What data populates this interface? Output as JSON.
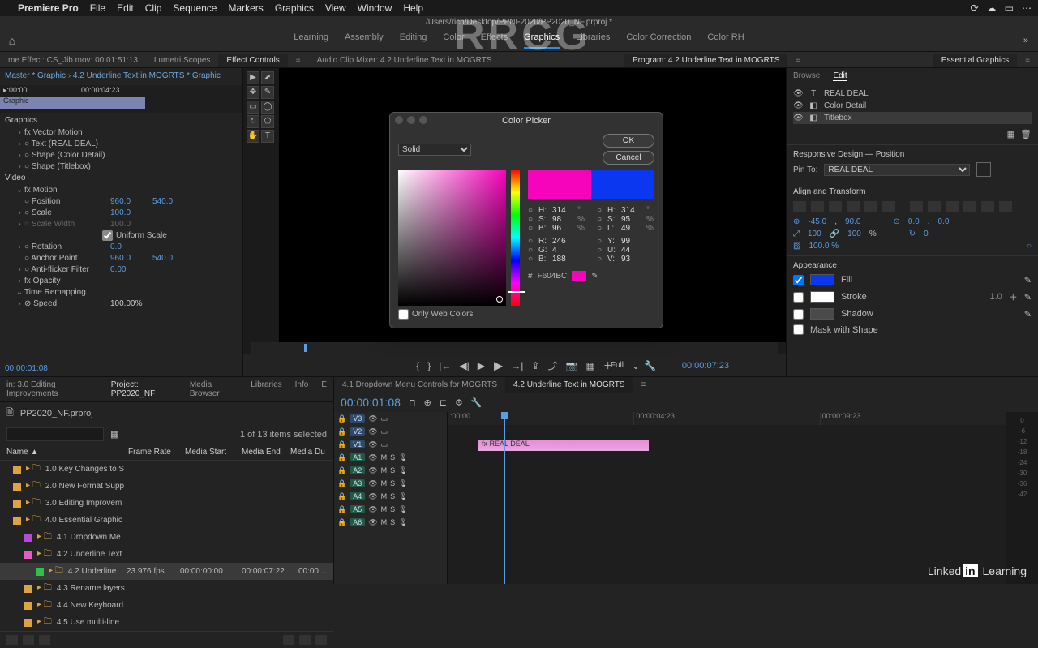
{
  "menubar": {
    "app": "Premiere Pro",
    "items": [
      "File",
      "Edit",
      "Clip",
      "Sequence",
      "Markers",
      "Graphics",
      "View",
      "Window",
      "Help"
    ]
  },
  "pathstrip": "/Users/rich/Desktop/PPNF2020/PP2020_NF.prproj *",
  "workspaces": {
    "items": [
      "Learning",
      "Assembly",
      "Editing",
      "Color",
      "Effects",
      "Graphics",
      "Libraries",
      "Color Correction",
      "Color RH"
    ],
    "active": 5
  },
  "top_tabs_left": {
    "frame_effect": "me Effect: CS_Jib.mov: 00:01:51:13",
    "lumetri": "Lumetri Scopes",
    "effect_controls": "Effect Controls",
    "audio_mixer": "Audio Clip Mixer: 4.2 Underline Text in MOGRTS"
  },
  "program_tab": "Program: 4.2 Underline Text in MOGRTS",
  "eg_title": "Essential Graphics",
  "effect_controls": {
    "crumb_master": "Master * Graphic",
    "crumb_target": "4.2 Underline Text in MOGRTS * Graphic",
    "tc_in": ":00:00",
    "tc_out": "00:00:04:23",
    "clip_label": "Graphic",
    "graphics_header": "Graphics",
    "items": [
      "Vector Motion",
      "Text (REAL DEAL)",
      "Shape (Color Detail)",
      "Shape (Titlebox)"
    ],
    "video_header": "Video",
    "motion": "Motion",
    "rows": [
      {
        "name": "Position",
        "v1": "960.0",
        "v2": "540.0"
      },
      {
        "name": "Scale",
        "v1": "100.0"
      },
      {
        "name": "Scale Width",
        "v1": "100.0"
      },
      {
        "name": "Uniform Scale",
        "check": true
      },
      {
        "name": "Rotation",
        "v1": "0.0"
      },
      {
        "name": "Anchor Point",
        "v1": "960.0",
        "v2": "540.0"
      },
      {
        "name": "Anti-flicker Filter",
        "v1": "0.00"
      }
    ],
    "opacity": "Opacity",
    "time_remap": "Time Remapping",
    "speed_label": "Speed",
    "speed_value": "100.00%",
    "bottom_tc": "00:00:01:08"
  },
  "transport": {
    "res": "Full",
    "tc": "00:00:07:23",
    "buttons": [
      "mark-in",
      "mark-out",
      "go-in",
      "step-back",
      "play",
      "step-fwd",
      "go-out",
      "lift",
      "extract",
      "export-frame",
      "btn1",
      "add"
    ]
  },
  "essential_graphics": {
    "tabs": [
      "Browse",
      "Edit"
    ],
    "active_tab": 1,
    "layers": [
      {
        "icon": "T",
        "label": "REAL DEAL"
      },
      {
        "icon": "shape",
        "label": "Color Detail"
      },
      {
        "icon": "shape",
        "label": "Titlebox"
      }
    ],
    "responsive_title": "Responsive Design — Position",
    "pin_label": "Pin To:",
    "pin_value": "REAL DEAL",
    "align_title": "Align and Transform",
    "nums": {
      "x": "-45.0",
      "y": "90.0",
      "ax": "0.0",
      "ay": "0.0",
      "sx": "100",
      "sy": "100",
      "rot": "0",
      "op": "100.0 %"
    },
    "appearance_title": "Appearance",
    "fill_label": "Fill",
    "fill_color": "#0b37f0",
    "stroke_label": "Stroke",
    "stroke_color": "#ffffff",
    "stroke_w": "1.0",
    "shadow_label": "Shadow",
    "shadow_color": "#4a4a4a",
    "mask_label": "Mask with Shape"
  },
  "project": {
    "tabs": [
      "in: 3.0 Editing Improvements",
      "Project: PP2020_NF",
      "Media Browser",
      "Libraries",
      "Info",
      "E"
    ],
    "active_tab": 1,
    "name": "PP2020_NF.prproj",
    "search_placeholder": "",
    "sel_info": "1 of 13 items selected",
    "cols": [
      "Name ▲",
      "Frame Rate",
      "Media Start",
      "Media End",
      "Media Du"
    ],
    "bins": [
      {
        "c": "#d9a441",
        "label": "1.0 Key Changes to S"
      },
      {
        "c": "#d9a441",
        "label": "2.0 New Format Supp"
      },
      {
        "c": "#d9a441",
        "label": "3.0 Editing Improvem"
      },
      {
        "c": "#d9a441",
        "label": "4.0 Essential Graphic"
      },
      {
        "c": "#b44bd8",
        "label": "4.1 Dropdown Me",
        "indent": 1
      },
      {
        "c": "#e65bbf",
        "label": "4.2 Underline Text",
        "indent": 1
      },
      {
        "c": "#2fbf4a",
        "label": "4.2 Underline",
        "indent": 2,
        "fr": "23.976 fps",
        "ms": "00:00:00:00",
        "me": "00:00:07:22",
        "md": "00:00…",
        "sel": true
      },
      {
        "c": "#d9a441",
        "label": "4.3 Rename layers",
        "indent": 1
      },
      {
        "c": "#d9a441",
        "label": "4.4 New Keyboard",
        "indent": 1
      },
      {
        "c": "#d9a441",
        "label": "4.5 Use multi-line",
        "indent": 1
      }
    ]
  },
  "timeline": {
    "tabs": [
      "4.1 Dropdown Menu Controls for MOGRTS",
      "4.2 Underline Text in MOGRTS"
    ],
    "active_tab": 1,
    "tc": "00:00:01:08",
    "ruler": [
      ":00:00",
      "00:00:04:23",
      "00:00:09:23"
    ],
    "tracks": [
      {
        "tag": "V3"
      },
      {
        "tag": "V2"
      },
      {
        "tag": "V1",
        "active": true
      },
      {
        "tag": "A1",
        "audio": true
      },
      {
        "tag": "A2",
        "audio": true
      },
      {
        "tag": "A3",
        "audio": true
      },
      {
        "tag": "A4",
        "audio": true
      },
      {
        "tag": "A5",
        "audio": true
      },
      {
        "tag": "A6",
        "audio": true
      }
    ],
    "clip_label": "REAL DEAL"
  },
  "meters": [
    "0",
    "-6",
    "-12",
    "-18",
    "-24",
    "-30",
    "-36",
    "-42"
  ],
  "color_picker": {
    "title": "Color Picker",
    "mode": "Solid",
    "ok": "OK",
    "cancel": "Cancel",
    "new_color": "#f604bc",
    "old_color": "#0b37f0",
    "hsb": [
      {
        "l": "H:",
        "v": "314",
        "u": "°"
      },
      {
        "l": "S:",
        "v": "98",
        "u": "%"
      },
      {
        "l": "B:",
        "v": "96",
        "u": "%"
      }
    ],
    "hsl": [
      {
        "l": "H:",
        "v": "314",
        "u": "°"
      },
      {
        "l": "S:",
        "v": "95",
        "u": "%"
      },
      {
        "l": "L:",
        "v": "49",
        "u": "%"
      }
    ],
    "rgb": [
      {
        "l": "R:",
        "v": "246"
      },
      {
        "l": "G:",
        "v": "4"
      },
      {
        "l": "B:",
        "v": "188"
      }
    ],
    "yuv": [
      {
        "l": "Y:",
        "v": "99"
      },
      {
        "l": "U:",
        "v": "44"
      },
      {
        "l": "V:",
        "v": "93"
      }
    ],
    "hex_label": "#",
    "hex": "F604BC",
    "webonly": "Only Web Colors"
  },
  "watermark_big": "RRCG",
  "linkedin": {
    "a": "Linked",
    "b": "in",
    "c": " Learning"
  }
}
